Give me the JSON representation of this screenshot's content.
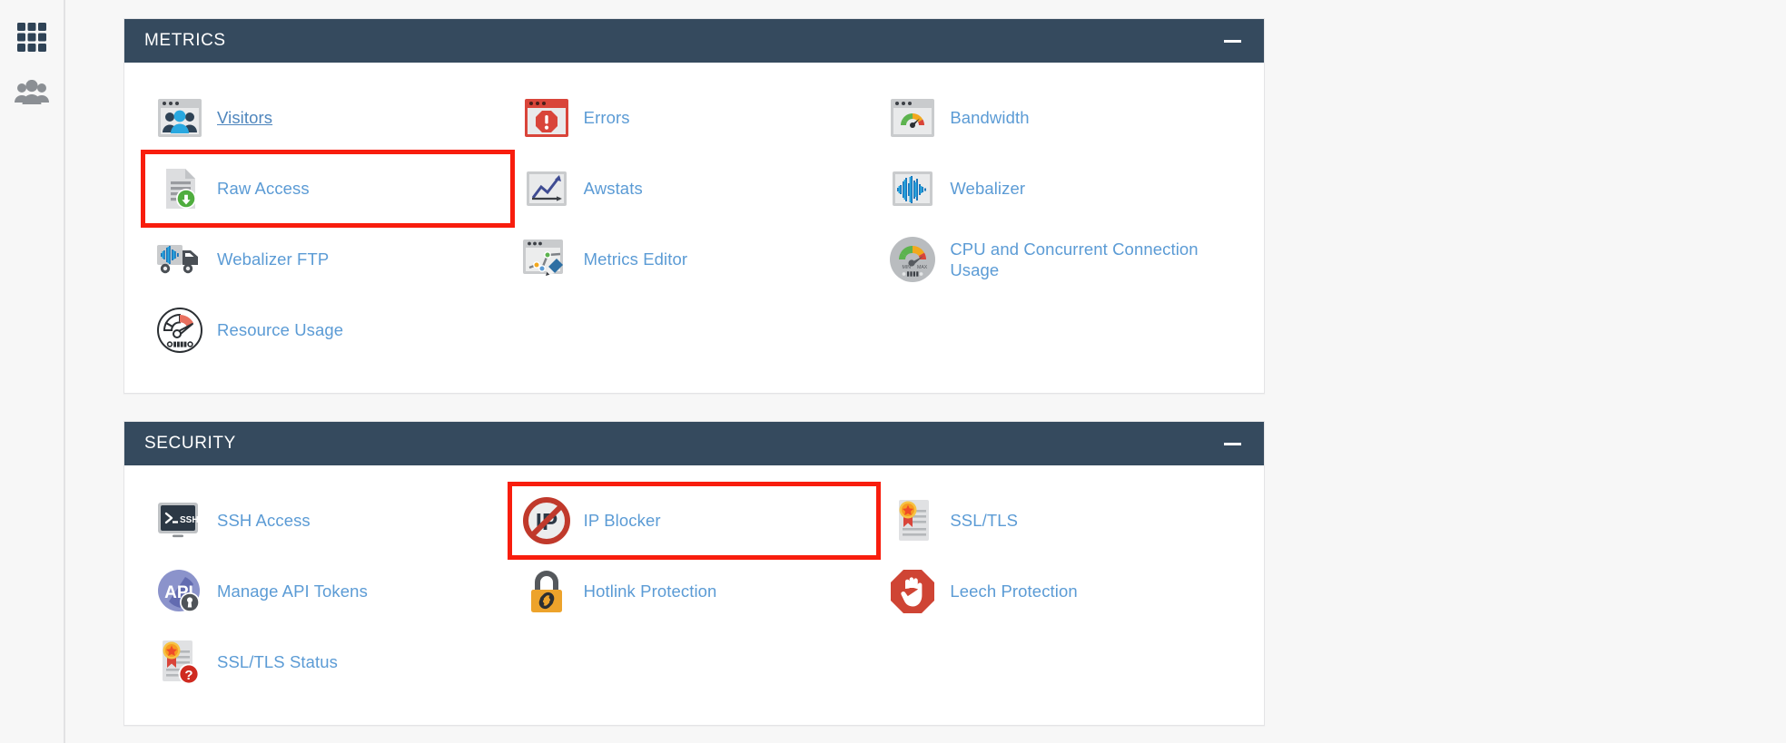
{
  "sidebar": {
    "items": [
      {
        "name": "apps-grid",
        "icon": "grid-apps-icon",
        "active": true
      },
      {
        "name": "user-manager",
        "icon": "users-group-icon",
        "active": false
      }
    ]
  },
  "colors": {
    "panel_header_bg": "#354a5e",
    "link": "#5b9bd5",
    "highlight_outline": "#f81d0d",
    "page_bg": "#f7f7f7"
  },
  "panels": [
    {
      "id": "metrics",
      "title": "METRICS",
      "collapse_label": "−",
      "items": [
        {
          "label": "Visitors",
          "icon": "visitors-icon",
          "highlight": false,
          "hovered": true
        },
        {
          "label": "Errors",
          "icon": "errors-icon",
          "highlight": false,
          "hovered": false
        },
        {
          "label": "Bandwidth",
          "icon": "bandwidth-icon",
          "highlight": false,
          "hovered": false
        },
        {
          "label": "Raw Access",
          "icon": "raw-access-icon",
          "highlight": true,
          "hovered": false
        },
        {
          "label": "Awstats",
          "icon": "awstats-icon",
          "highlight": false,
          "hovered": false
        },
        {
          "label": "Webalizer",
          "icon": "webalizer-icon",
          "highlight": false,
          "hovered": false
        },
        {
          "label": "Webalizer FTP",
          "icon": "webalizer-ftp-icon",
          "highlight": false,
          "hovered": false
        },
        {
          "label": "Metrics Editor",
          "icon": "metrics-editor-icon",
          "highlight": false,
          "hovered": false
        },
        {
          "label": "CPU and Concurrent Connection Usage",
          "icon": "cpu-usage-icon",
          "highlight": false,
          "hovered": false
        },
        {
          "label": "Resource Usage",
          "icon": "resource-usage-icon",
          "highlight": false,
          "hovered": false
        }
      ]
    },
    {
      "id": "security",
      "title": "SECURITY",
      "collapse_label": "−",
      "items": [
        {
          "label": "SSH Access",
          "icon": "ssh-terminal-icon",
          "highlight": false,
          "hovered": false
        },
        {
          "label": "IP Blocker",
          "icon": "ip-blocker-icon",
          "highlight": true,
          "hovered": false
        },
        {
          "label": "SSL/TLS",
          "icon": "ssl-certificate-icon",
          "highlight": false,
          "hovered": false
        },
        {
          "label": "Manage API Tokens",
          "icon": "api-token-icon",
          "highlight": false,
          "hovered": false
        },
        {
          "label": "Hotlink Protection",
          "icon": "hotlink-padlock-icon",
          "highlight": false,
          "hovered": false
        },
        {
          "label": "Leech Protection",
          "icon": "leech-stop-hand-icon",
          "highlight": false,
          "hovered": false
        },
        {
          "label": "SSL/TLS Status",
          "icon": "ssl-status-icon",
          "highlight": false,
          "hovered": false
        }
      ]
    }
  ]
}
